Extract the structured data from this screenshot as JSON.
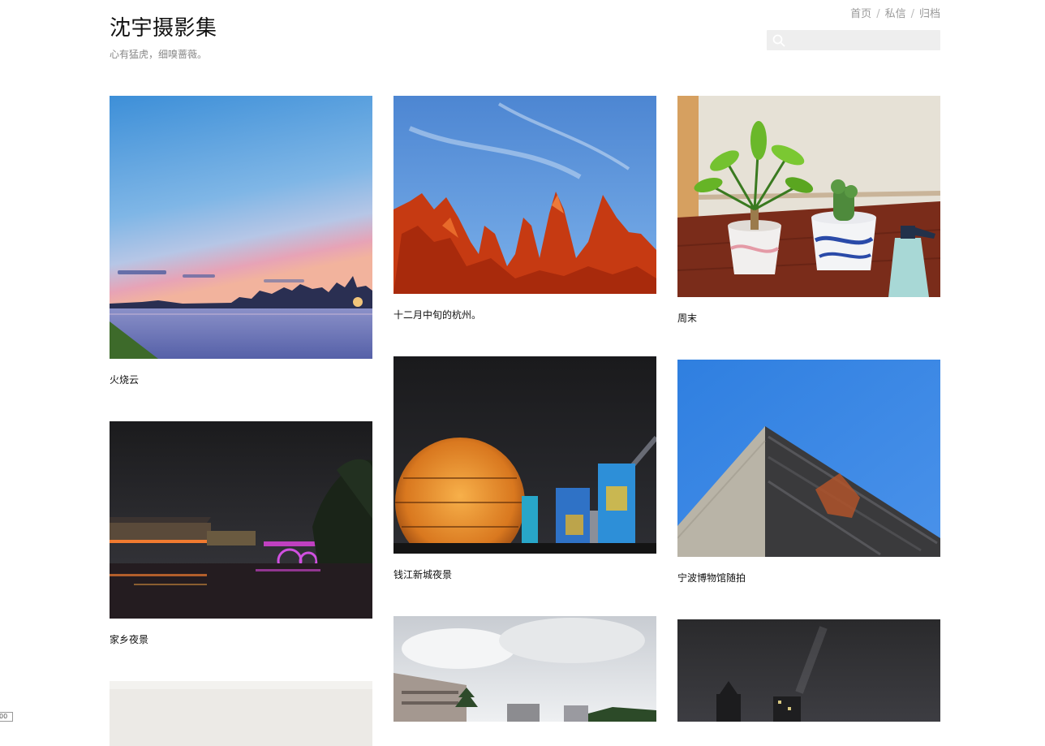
{
  "site": {
    "title": "沈宇摄影集",
    "tagline": "心有猛虎，细嗅蔷薇。"
  },
  "nav": {
    "items": [
      "首页",
      "私信",
      "归档"
    ],
    "separator": "/"
  },
  "search": {
    "value": "",
    "placeholder": ""
  },
  "posts": [
    {
      "caption": "火烧云"
    },
    {
      "caption": "十二月中旬的杭州。"
    },
    {
      "caption": "周末"
    },
    {
      "caption": "家乡夜景"
    },
    {
      "caption": "钱江新城夜景"
    },
    {
      "caption": "宁波博物馆随拍"
    }
  ],
  "corner_label": "00",
  "colors": {
    "title": "#111111",
    "muted": "#888888",
    "nav": "#999999",
    "search_bg": "#eeeeee"
  }
}
